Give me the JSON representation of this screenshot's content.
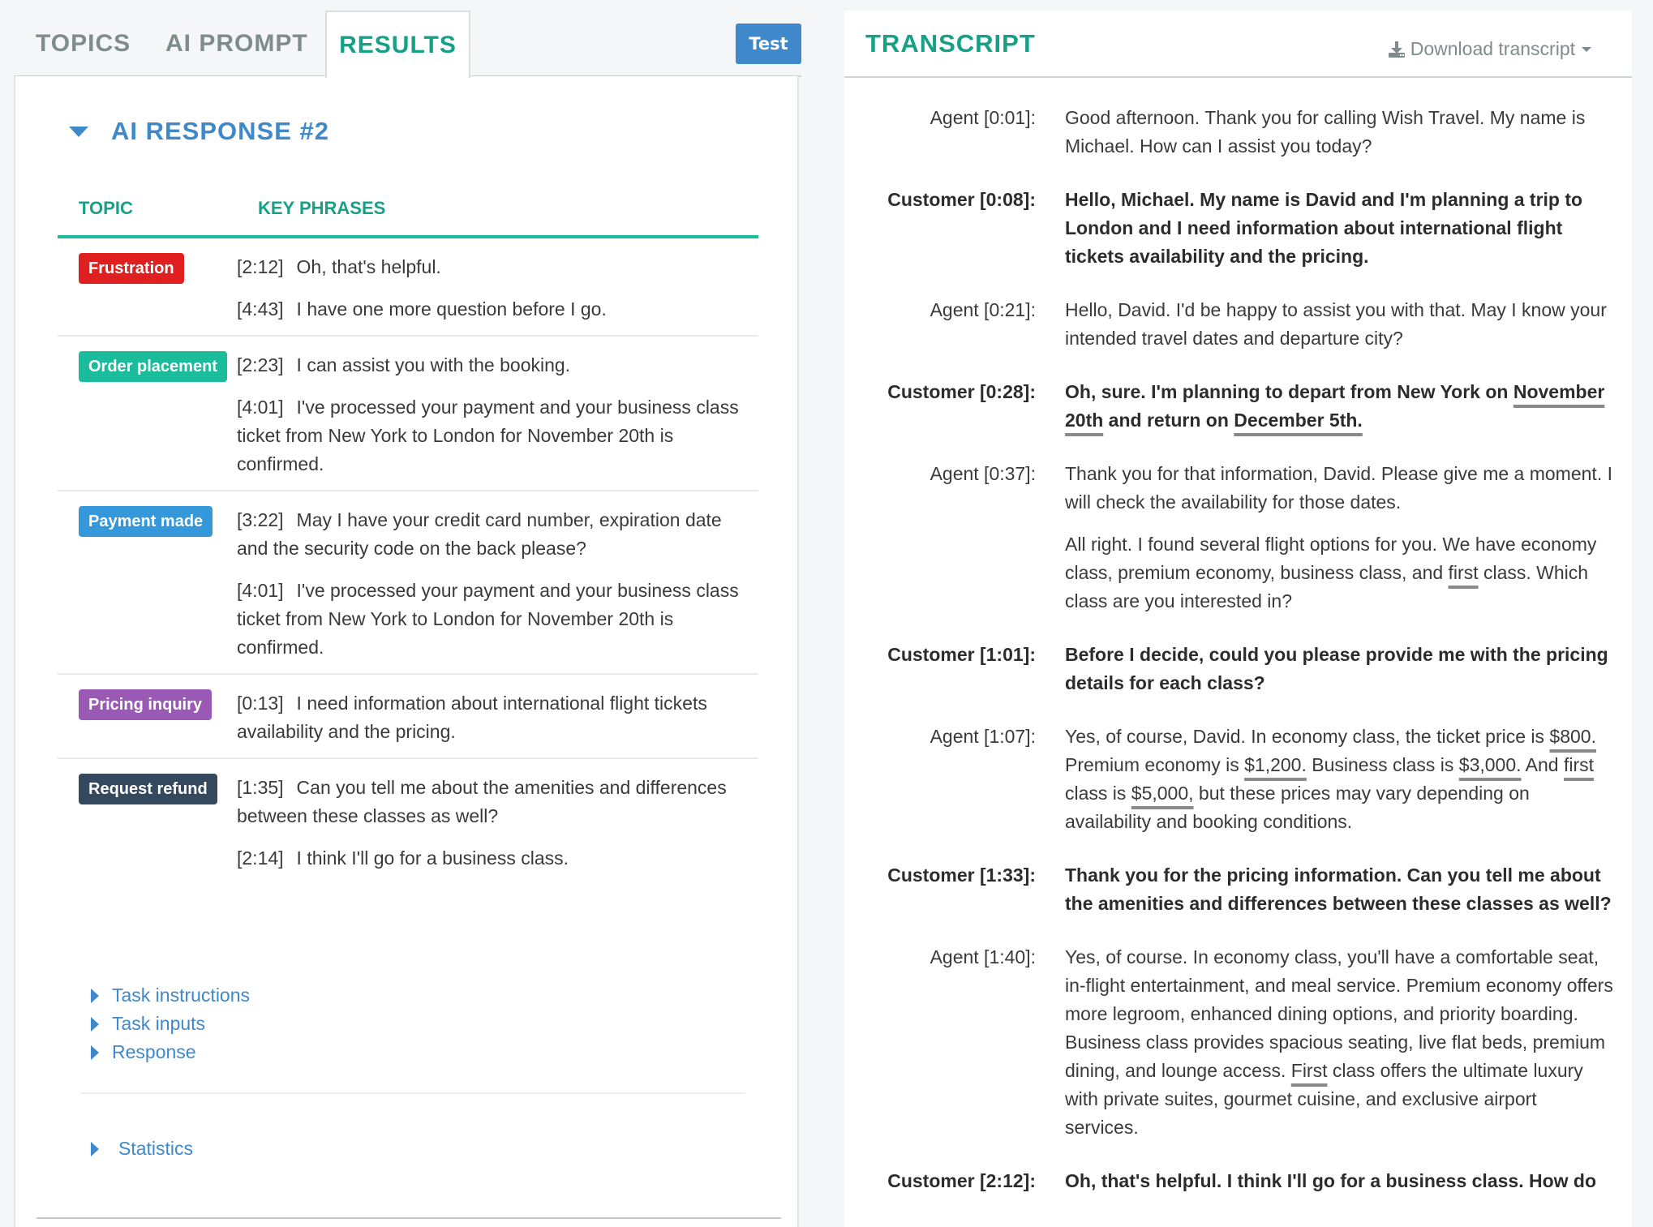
{
  "left": {
    "tabs": [
      {
        "label": "TOPICS",
        "active": false
      },
      {
        "label": "AI PROMPT",
        "active": false
      },
      {
        "label": "RESULTS",
        "active": true
      }
    ],
    "test_button": "Test",
    "response_title": "AI RESPONSE #2",
    "columns": {
      "topic": "TOPIC",
      "key_phrases": "KEY PHRASES"
    },
    "rows": [
      {
        "topic": "Frustration",
        "color": "#e02020",
        "phrases": [
          {
            "ts": "[2:12]",
            "text": "Oh, that's helpful."
          },
          {
            "ts": "[4:43]",
            "text": "I have one more question before I go."
          }
        ]
      },
      {
        "topic": "Order placement",
        "color": "#1abc9c",
        "phrases": [
          {
            "ts": "[2:23]",
            "text": "I can assist you with the booking."
          },
          {
            "ts": "[4:01]",
            "text": "I've processed your payment and your business class ticket from New York to London for November 20th is confirmed."
          }
        ]
      },
      {
        "topic": "Payment made",
        "color": "#3498db",
        "phrases": [
          {
            "ts": "[3:22]",
            "text": "May I have your credit card number, expiration date and the security code on the back please?"
          },
          {
            "ts": "[4:01]",
            "text": "I've processed your payment and your business class ticket from New York to London for November 20th is confirmed."
          }
        ]
      },
      {
        "topic": "Pricing inquiry",
        "color": "#9b59b6",
        "phrases": [
          {
            "ts": "[0:13]",
            "text": "I need information about international flight tickets availability and the pricing."
          }
        ]
      },
      {
        "topic": "Request refund",
        "color": "#34495e",
        "phrases": [
          {
            "ts": "[1:35]",
            "text": "Can you tell me about the amenities and differences between these classes as well?"
          },
          {
            "ts": "[2:14]",
            "text": "I think I'll go for a business class."
          }
        ]
      }
    ],
    "links": [
      "Task instructions",
      "Task inputs",
      "Response"
    ],
    "statistics_label": "Statistics"
  },
  "transcript": {
    "title": "TRANSCRIPT",
    "download_label": "Download transcript",
    "turns": [
      {
        "speaker": "Agent [0:01]:",
        "role": "agent",
        "utterances": [
          [
            {
              "t": "Good afternoon. Thank you for calling Wish Travel. My name is Michael. How can I assist you today?"
            }
          ]
        ]
      },
      {
        "speaker": "Customer [0:08]:",
        "role": "customer",
        "utterances": [
          [
            {
              "t": "Hello, Michael. My name is David and I'm planning a trip to London and I need information about international flight tickets availability and the pricing."
            }
          ]
        ]
      },
      {
        "speaker": "Agent [0:21]:",
        "role": "agent",
        "utterances": [
          [
            {
              "t": "Hello, David. I'd be happy to assist you with that. May I know your intended travel dates and departure city?"
            }
          ]
        ]
      },
      {
        "speaker": "Customer [0:28]:",
        "role": "customer",
        "utterances": [
          [
            {
              "t": "Oh, sure. I'm planning to depart from New York on "
            },
            {
              "t": "November 20th",
              "hl": true
            },
            {
              "t": " and return on "
            },
            {
              "t": "December 5th.",
              "hl": true
            }
          ]
        ]
      },
      {
        "speaker": "Agent [0:37]:",
        "role": "agent",
        "utterances": [
          [
            {
              "t": "Thank you for that information, David. Please give me a moment. I will check the availability for those dates."
            }
          ],
          [
            {
              "t": "All right. I found several flight options for you. We have economy class, premium economy, business class, and "
            },
            {
              "t": "first",
              "hl": true
            },
            {
              "t": " class. Which class are you interested in?"
            }
          ]
        ]
      },
      {
        "speaker": "Customer [1:01]:",
        "role": "customer",
        "utterances": [
          [
            {
              "t": "Before I decide, could you please provide me with the pricing details for each class?"
            }
          ]
        ]
      },
      {
        "speaker": "Agent [1:07]:",
        "role": "agent",
        "utterances": [
          [
            {
              "t": "Yes, of course, David. In economy class, the ticket price is "
            },
            {
              "t": "$800.",
              "hl": true
            },
            {
              "t": " Premium economy is "
            },
            {
              "t": "$1,200.",
              "hl": true
            },
            {
              "t": " Business class is "
            },
            {
              "t": "$3,000.",
              "hl": true
            },
            {
              "t": " And "
            },
            {
              "t": "first",
              "hl": true
            },
            {
              "t": " class is "
            },
            {
              "t": "$5,000,",
              "hl": true
            },
            {
              "t": " but these prices may vary depending on availability and booking conditions."
            }
          ]
        ]
      },
      {
        "speaker": "Customer [1:33]:",
        "role": "customer",
        "utterances": [
          [
            {
              "t": "Thank you for the pricing information. Can you tell me about the amenities and differences between these classes as well?"
            }
          ]
        ]
      },
      {
        "speaker": "Agent [1:40]:",
        "role": "agent",
        "utterances": [
          [
            {
              "t": "Yes, of course. In economy class, you'll have a comfortable seat, in-flight entertainment, and meal service. Premium economy offers more legroom, enhanced dining options, and priority boarding. Business class provides spacious seating, live flat beds, premium dining, and lounge access. "
            },
            {
              "t": "First",
              "hl": true
            },
            {
              "t": " class offers the ultimate luxury with private suites, gourmet cuisine, and exclusive airport services."
            }
          ]
        ]
      },
      {
        "speaker": "Customer [2:12]:",
        "role": "customer",
        "utterances": [
          [
            {
              "t": "Oh, that's helpful. I think I'll go for a business class. How do"
            }
          ]
        ]
      }
    ]
  }
}
